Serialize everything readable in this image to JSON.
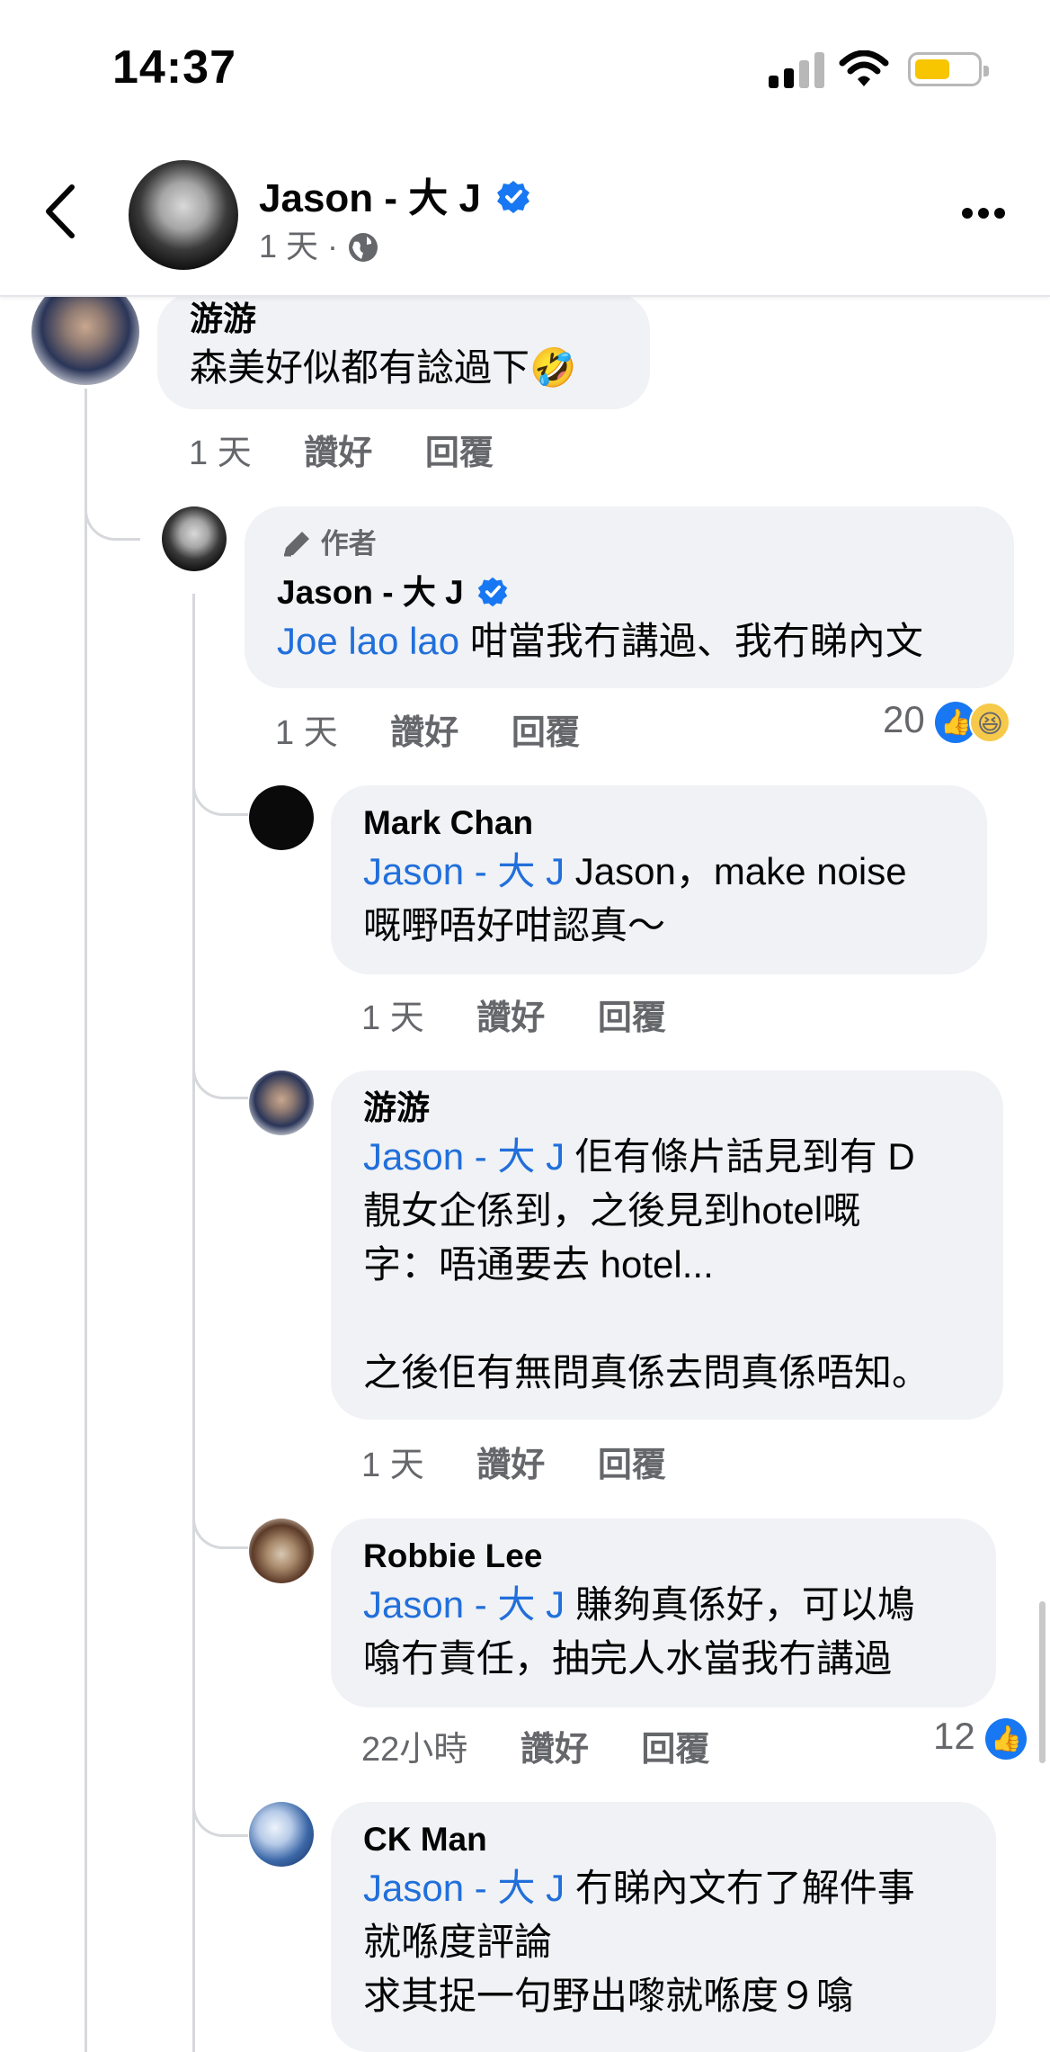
{
  "status_bar": {
    "time": "14:37"
  },
  "header": {
    "name": "Jason - 大 J",
    "meta": "1 天 ·"
  },
  "comments": [
    {
      "name": "游游",
      "text": "森美好似都有諗過下",
      "emoji": "🤣",
      "time": "1 天",
      "like_label": "讚好",
      "reply_label": "回覆"
    },
    {
      "author_badge": "作者",
      "name": "Jason - 大 J",
      "mention": "Joe lao lao",
      "text": " 咁當我冇講過、我冇睇內文",
      "time": "1 天",
      "like_label": "讚好",
      "reply_label": "回覆",
      "reaction_count": "20"
    },
    {
      "name": "Mark Chan",
      "mention": "Jason - 大 J",
      "text_line1": " Jason，make noise",
      "text_line2": "嘅嘢唔好咁認真～",
      "time": "1 天",
      "like_label": "讚好",
      "reply_label": "回覆"
    },
    {
      "name": "游游",
      "mention": "Jason - 大 J",
      "text_line1": " 佢有條片話見到有 D",
      "text_line2": "靚女企係到，之後見到hotel嘅",
      "text_line3": "字：唔通要去 hotel...",
      "text_line4": "之後佢有無問真係去問真係唔知。",
      "time": "1 天",
      "like_label": "讚好",
      "reply_label": "回覆"
    },
    {
      "name": "Robbie Lee",
      "mention": "Jason - 大 J",
      "text_line1": " 賺夠真係好，可以鳩",
      "text_line2": "噏冇責任，抽完人水當我冇講過",
      "time": "22小時",
      "like_label": "讚好",
      "reply_label": "回覆",
      "reaction_count": "12"
    },
    {
      "name": "CK Man",
      "mention": "Jason - 大 J",
      "text_line1": " 冇睇內文冇了解件事",
      "text_line2": "就喺度評論",
      "text_line3": "求其捉一句野出嚟就喺度９噏"
    }
  ],
  "icons": {
    "verified": "verified-badge-icon",
    "globe": "globe-icon",
    "back": "chevron-left-icon",
    "more": "more-dots-icon",
    "author": "pencil-icon",
    "like_reaction": "like-reaction-icon",
    "haha_reaction": "haha-reaction-icon"
  },
  "colors": {
    "mention": "#216fdb",
    "like": "#1877f2",
    "bubble": "#f0f2f5"
  }
}
